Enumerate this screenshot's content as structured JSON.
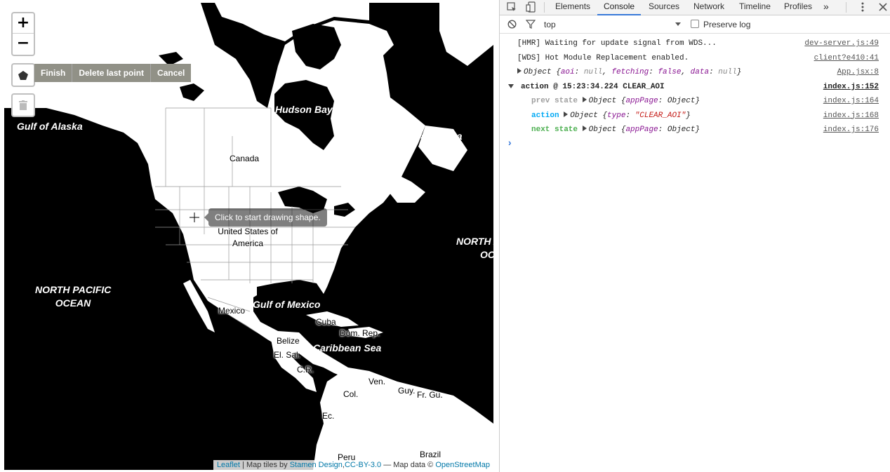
{
  "map": {
    "zoom_in": "+",
    "zoom_out": "−",
    "draw_actions": [
      "Finish",
      "Delete last point",
      "Cancel"
    ],
    "tooltip": "Click to start drawing shape.",
    "labels": {
      "gulf_of_alaska": "Gulf of Alaska",
      "hudson_bay": "Hudson Bay",
      "labrador_sea": "Labrador Sea",
      "canada": "Canada",
      "usa_line1": "United States of",
      "usa_line2": "America",
      "north_pacific_line1": "NORTH PACIFIC",
      "north_pacific_line2": "OCEAN",
      "north_atlantic_line1": "NORTH A",
      "north_atlantic_line2": "OC",
      "mexico": "Mexico",
      "gulf_of_mexico": "Gulf of Mexico",
      "cuba": "Cuba",
      "dom_rep": "Dom. Rep.",
      "belize": "Belize",
      "el_sal": "El. Sal.",
      "caribbean": "Caribbean Sea",
      "cr": "C.R.",
      "ven": "Ven.",
      "guy": "Guy.",
      "fr_gu": "Fr. Gu.",
      "col": "Col.",
      "ec": "Ec.",
      "peru": "Peru",
      "brazil": "Brazil"
    },
    "attribution": {
      "leaflet": "Leaflet",
      "sep1": " | Map tiles by ",
      "stamen": "Stamen Design",
      "comma": ",",
      "license": "CC-BY-3.0",
      "sep2": " — Map data © ",
      "osm": "OpenStreetMap"
    }
  },
  "devtools": {
    "tabs": [
      "Elements",
      "Console",
      "Sources",
      "Network",
      "Timeline",
      "Profiles"
    ],
    "active_tab": "Console",
    "more": "»",
    "context": "top",
    "preserve_log": "Preserve log",
    "accent": "#3879d9",
    "messages": [
      {
        "text": "[HMR] Waiting for update signal from WDS...",
        "source": "dev-server.js:49"
      },
      {
        "text": "[WDS] Hot Module Replacement enabled.",
        "source": "client?e410:41"
      },
      {
        "prefix": "Object {",
        "k1": "aoi",
        "v1": "null",
        "k2": "fetching",
        "v2": "false",
        "k3": "data",
        "v3": "null",
        "suffix": "}",
        "source": "App.jsx:8"
      },
      {
        "text": "action @ 15:23:34.224 CLEAR_AOI",
        "source": "index.js:152"
      },
      {
        "label": "prev state",
        "obj": "Object {",
        "key": "appPage",
        "val": "Object",
        "end": "}",
        "source": "index.js:164",
        "color": "#9e9e9e"
      },
      {
        "label": "action",
        "obj": "Object {",
        "key": "type",
        "val": "\"CLEAR_AOI\"",
        "end": "}",
        "source": "index.js:168",
        "color": "#03a9f4"
      },
      {
        "label": "next state",
        "obj": "Object {",
        "key": "appPage",
        "val": "Object",
        "end": "}",
        "source": "index.js:176",
        "color": "#4caf50"
      }
    ],
    "prompt": "›"
  }
}
